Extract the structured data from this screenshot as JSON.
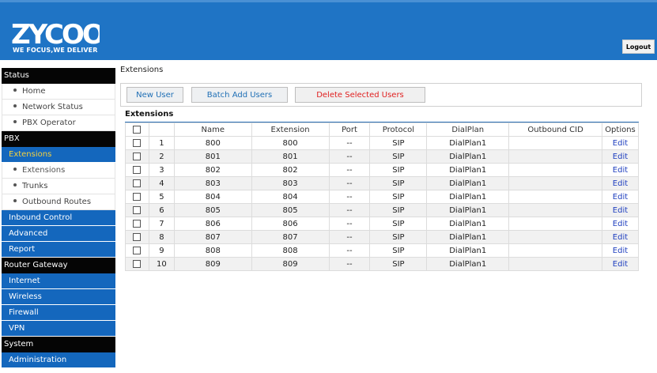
{
  "brand": {
    "logo_text": "ZYCOO",
    "tagline": "WE FOCUS,WE DELIVER",
    "color": "#1f74c5"
  },
  "header": {
    "logout_label": "Logout"
  },
  "sidebar": {
    "status_title": "Status",
    "status_items": [
      "Home",
      "Network Status",
      "PBX Operator"
    ],
    "pbx_title": "PBX",
    "extensions_label": "Extensions",
    "pbx_items": [
      "Extensions",
      "Trunks",
      "Outbound Routes"
    ],
    "pbx_blue_items": [
      "Inbound Control",
      "Advanced",
      "Report"
    ],
    "router_title": "Router Gateway",
    "router_items": [
      "Internet",
      "Wireless",
      "Firewall",
      "VPN"
    ],
    "system_title": "System",
    "system_items": [
      "Administration"
    ]
  },
  "main": {
    "page_title": "Extensions",
    "toolbar": {
      "new_user": "New User",
      "batch_add": "Batch Add Users",
      "delete_selected": "Delete Selected Users"
    },
    "section_title": "Extensions",
    "columns": [
      "",
      "",
      "Name",
      "Extension",
      "Port",
      "Protocol",
      "DialPlan",
      "Outbound CID",
      "Options"
    ],
    "rows": [
      {
        "n": "1",
        "name": "800",
        "ext": "800",
        "port": "--",
        "protocol": "SIP",
        "dialplan": "DialPlan1",
        "cid": "",
        "option": "Edit"
      },
      {
        "n": "2",
        "name": "801",
        "ext": "801",
        "port": "--",
        "protocol": "SIP",
        "dialplan": "DialPlan1",
        "cid": "",
        "option": "Edit"
      },
      {
        "n": "3",
        "name": "802",
        "ext": "802",
        "port": "--",
        "protocol": "SIP",
        "dialplan": "DialPlan1",
        "cid": "",
        "option": "Edit"
      },
      {
        "n": "4",
        "name": "803",
        "ext": "803",
        "port": "--",
        "protocol": "SIP",
        "dialplan": "DialPlan1",
        "cid": "",
        "option": "Edit"
      },
      {
        "n": "5",
        "name": "804",
        "ext": "804",
        "port": "--",
        "protocol": "SIP",
        "dialplan": "DialPlan1",
        "cid": "",
        "option": "Edit"
      },
      {
        "n": "6",
        "name": "805",
        "ext": "805",
        "port": "--",
        "protocol": "SIP",
        "dialplan": "DialPlan1",
        "cid": "",
        "option": "Edit"
      },
      {
        "n": "7",
        "name": "806",
        "ext": "806",
        "port": "--",
        "protocol": "SIP",
        "dialplan": "DialPlan1",
        "cid": "",
        "option": "Edit"
      },
      {
        "n": "8",
        "name": "807",
        "ext": "807",
        "port": "--",
        "protocol": "SIP",
        "dialplan": "DialPlan1",
        "cid": "",
        "option": "Edit"
      },
      {
        "n": "9",
        "name": "808",
        "ext": "808",
        "port": "--",
        "protocol": "SIP",
        "dialplan": "DialPlan1",
        "cid": "",
        "option": "Edit"
      },
      {
        "n": "10",
        "name": "809",
        "ext": "809",
        "port": "--",
        "protocol": "SIP",
        "dialplan": "DialPlan1",
        "cid": "",
        "option": "Edit"
      }
    ]
  }
}
